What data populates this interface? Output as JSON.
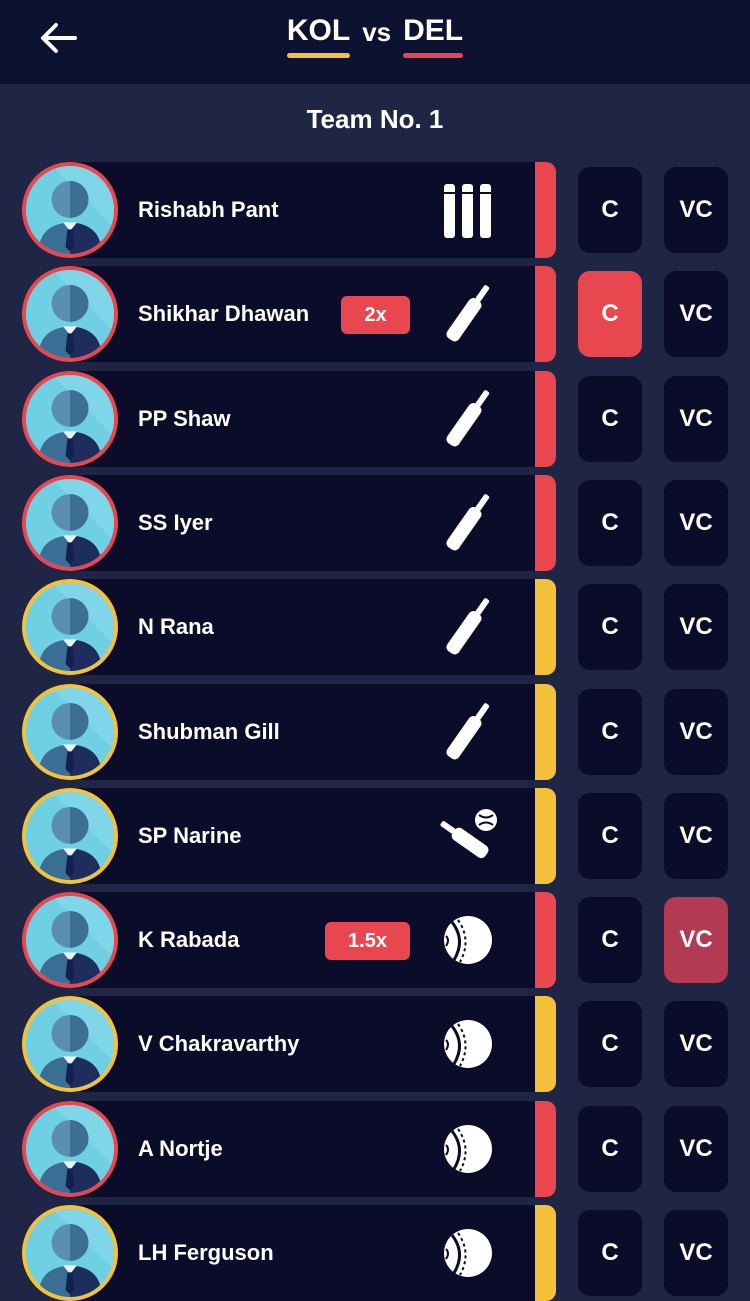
{
  "header": {
    "team_a": "KOL",
    "team_b": "DEL",
    "vs": "vs",
    "team_a_color": "#f3c13a",
    "team_b_color": "#e8474f",
    "back_icon": "arrow-left-icon"
  },
  "team_title": "Team No.  1",
  "button_labels": {
    "captain": "C",
    "vice_captain": "VC"
  },
  "colors": {
    "background": "#1f2545",
    "card": "#0b0c2a",
    "kol": "#f3c13a",
    "del": "#e8474f",
    "captain_selected": "#e8474f",
    "vc_selected": "#b23a52"
  },
  "players": [
    {
      "name": "Rishabh Pant",
      "team": "DEL",
      "role_icon": "stumps-icon",
      "multiplier": "",
      "captain": false,
      "vice_captain": false
    },
    {
      "name": "Shikhar Dhawan",
      "team": "DEL",
      "role_icon": "bat-icon",
      "multiplier": "2x",
      "captain": true,
      "vice_captain": false
    },
    {
      "name": "PP Shaw",
      "team": "DEL",
      "role_icon": "bat-icon",
      "multiplier": "",
      "captain": false,
      "vice_captain": false
    },
    {
      "name": "SS Iyer",
      "team": "DEL",
      "role_icon": "bat-icon",
      "multiplier": "",
      "captain": false,
      "vice_captain": false
    },
    {
      "name": "N Rana",
      "team": "KOL",
      "role_icon": "bat-icon",
      "multiplier": "",
      "captain": false,
      "vice_captain": false
    },
    {
      "name": "Shubman Gill",
      "team": "KOL",
      "role_icon": "bat-icon",
      "multiplier": "",
      "captain": false,
      "vice_captain": false
    },
    {
      "name": "SP Narine",
      "team": "KOL",
      "role_icon": "bat-ball-icon",
      "multiplier": "",
      "captain": false,
      "vice_captain": false
    },
    {
      "name": "K Rabada",
      "team": "DEL",
      "role_icon": "ball-icon",
      "multiplier": "1.5x",
      "captain": false,
      "vice_captain": true
    },
    {
      "name": "V Chakravarthy",
      "team": "KOL",
      "role_icon": "ball-icon",
      "multiplier": "",
      "captain": false,
      "vice_captain": false
    },
    {
      "name": "A Nortje",
      "team": "DEL",
      "role_icon": "ball-icon",
      "multiplier": "",
      "captain": false,
      "vice_captain": false
    },
    {
      "name": "LH Ferguson",
      "team": "KOL",
      "role_icon": "ball-icon",
      "multiplier": "",
      "captain": false,
      "vice_captain": false
    }
  ]
}
